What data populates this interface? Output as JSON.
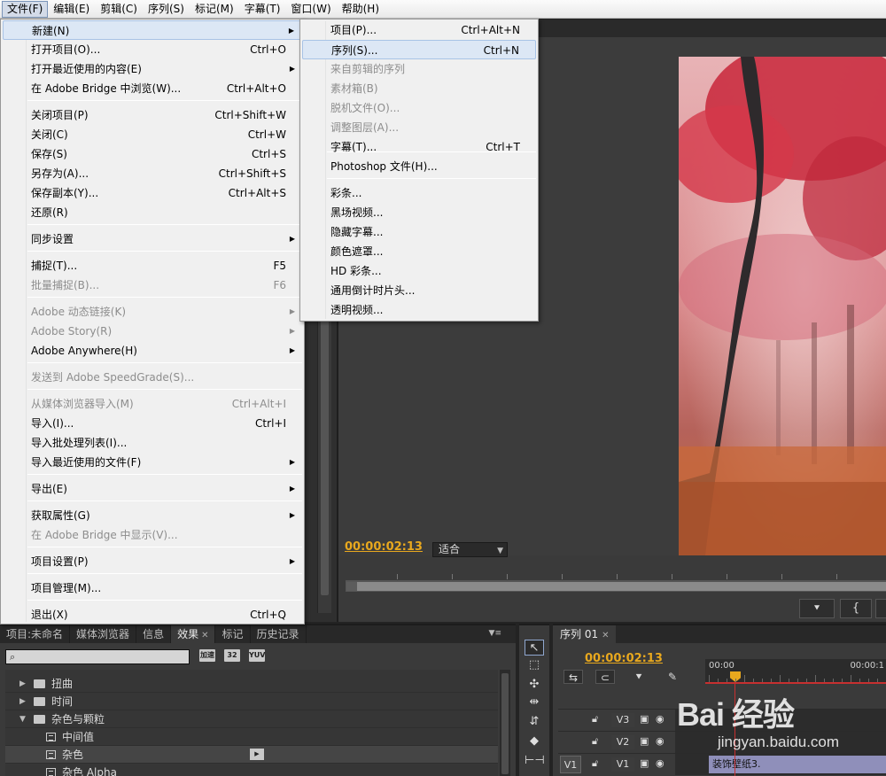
{
  "menubar": {
    "items": [
      {
        "label": "文件(F)"
      },
      {
        "label": "编辑(E)"
      },
      {
        "label": "剪辑(C)"
      },
      {
        "label": "序列(S)"
      },
      {
        "label": "标记(M)"
      },
      {
        "label": "字幕(T)"
      },
      {
        "label": "窗口(W)"
      },
      {
        "label": "帮助(H)"
      }
    ]
  },
  "file_menu": {
    "items": [
      {
        "label": "新建(N)",
        "shortcut": "",
        "submenu": true,
        "disabled": false,
        "highlighted": true
      },
      {
        "label": "打开项目(O)...",
        "shortcut": "Ctrl+O",
        "submenu": false,
        "disabled": false
      },
      {
        "label": "打开最近使用的内容(E)",
        "shortcut": "",
        "submenu": true,
        "disabled": false
      },
      {
        "label": "在 Adobe Bridge 中浏览(W)...",
        "shortcut": "Ctrl+Alt+O",
        "submenu": false,
        "disabled": false
      },
      {
        "label": "关闭项目(P)",
        "shortcut": "Ctrl+Shift+W",
        "submenu": false,
        "disabled": false
      },
      {
        "label": "关闭(C)",
        "shortcut": "Ctrl+W",
        "submenu": false,
        "disabled": false
      },
      {
        "label": "保存(S)",
        "shortcut": "Ctrl+S",
        "submenu": false,
        "disabled": false
      },
      {
        "label": "另存为(A)...",
        "shortcut": "Ctrl+Shift+S",
        "submenu": false,
        "disabled": false
      },
      {
        "label": "保存副本(Y)...",
        "shortcut": "Ctrl+Alt+S",
        "submenu": false,
        "disabled": false
      },
      {
        "label": "还原(R)",
        "shortcut": "",
        "submenu": false,
        "disabled": false
      },
      {
        "label": "同步设置",
        "shortcut": "",
        "submenu": true,
        "disabled": false
      },
      {
        "label": "捕捉(T)...",
        "shortcut": "F5",
        "submenu": false,
        "disabled": false
      },
      {
        "label": "批量捕捉(B)...",
        "shortcut": "F6",
        "submenu": false,
        "disabled": true
      },
      {
        "label": "Adobe 动态链接(K)",
        "shortcut": "",
        "submenu": true,
        "disabled": true
      },
      {
        "label": "Adobe Story(R)",
        "shortcut": "",
        "submenu": true,
        "disabled": true
      },
      {
        "label": "Adobe Anywhere(H)",
        "shortcut": "",
        "submenu": true,
        "disabled": false
      },
      {
        "label": "发送到 Adobe SpeedGrade(S)...",
        "shortcut": "",
        "submenu": false,
        "disabled": true
      },
      {
        "label": "从媒体浏览器导入(M)",
        "shortcut": "Ctrl+Alt+I",
        "submenu": false,
        "disabled": true
      },
      {
        "label": "导入(I)...",
        "shortcut": "Ctrl+I",
        "submenu": false,
        "disabled": false
      },
      {
        "label": "导入批处理列表(I)...",
        "shortcut": "",
        "submenu": false,
        "disabled": false
      },
      {
        "label": "导入最近使用的文件(F)",
        "shortcut": "",
        "submenu": true,
        "disabled": false
      },
      {
        "label": "导出(E)",
        "shortcut": "",
        "submenu": true,
        "disabled": false
      },
      {
        "label": "获取属性(G)",
        "shortcut": "",
        "submenu": true,
        "disabled": false
      },
      {
        "label": "在 Adobe Bridge 中显示(V)...",
        "shortcut": "",
        "submenu": false,
        "disabled": true
      },
      {
        "label": "项目设置(P)",
        "shortcut": "",
        "submenu": true,
        "disabled": false
      },
      {
        "label": "项目管理(M)...",
        "shortcut": "",
        "submenu": false,
        "disabled": false
      },
      {
        "label": "退出(X)",
        "shortcut": "Ctrl+Q",
        "submenu": false,
        "disabled": false
      }
    ]
  },
  "new_submenu": {
    "items": [
      {
        "label": "项目(P)...",
        "shortcut": "Ctrl+Alt+N",
        "disabled": false
      },
      {
        "label": "序列(S)...",
        "shortcut": "Ctrl+N",
        "disabled": false,
        "highlighted": true
      },
      {
        "label": "来自剪辑的序列",
        "shortcut": "",
        "disabled": true
      },
      {
        "label": "素材箱(B)",
        "shortcut": "",
        "disabled": true
      },
      {
        "label": "脱机文件(O)...",
        "shortcut": "",
        "disabled": true
      },
      {
        "label": "调整图层(A)...",
        "shortcut": "",
        "disabled": true
      },
      {
        "label": "字幕(T)...",
        "shortcut": "Ctrl+T",
        "disabled": false
      },
      {
        "label": "Photoshop 文件(H)...",
        "shortcut": "",
        "disabled": false
      },
      {
        "label": "彩条...",
        "shortcut": "",
        "disabled": false
      },
      {
        "label": "黑场视频...",
        "shortcut": "",
        "disabled": false
      },
      {
        "label": "隐藏字幕...",
        "shortcut": "",
        "disabled": false
      },
      {
        "label": "颜色遮罩...",
        "shortcut": "",
        "disabled": false
      },
      {
        "label": "HD 彩条...",
        "shortcut": "",
        "disabled": false
      },
      {
        "label": "通用倒计时片头...",
        "shortcut": "",
        "disabled": false
      },
      {
        "label": "透明视频...",
        "shortcut": "",
        "disabled": false
      }
    ]
  },
  "program_monitor": {
    "timecode": "00:00:02:13",
    "fit_label": "适合",
    "in_button_icon": "{",
    "marker_button_icon": "marker-icon"
  },
  "effects_panel": {
    "tabs": [
      {
        "label": "项目:未命名",
        "active": false,
        "closable": false
      },
      {
        "label": "媒体浏览器",
        "active": false,
        "closable": false
      },
      {
        "label": "信息",
        "active": false,
        "closable": false
      },
      {
        "label": "效果",
        "active": true,
        "closable": true
      },
      {
        "label": "标记",
        "active": false,
        "closable": false
      },
      {
        "label": "历史记录",
        "active": false,
        "closable": false
      }
    ],
    "tool_icons": [
      "accelerated-effects-icon",
      "32-bit-icon",
      "yuv-icon"
    ],
    "tool_labels": [
      "加速",
      "32",
      "YUV"
    ],
    "rows": [
      {
        "label": "扭曲",
        "type": "folder",
        "expanded": false
      },
      {
        "label": "时间",
        "type": "folder",
        "expanded": false
      },
      {
        "label": "杂色与颗粒",
        "type": "folder",
        "expanded": true
      },
      {
        "label": "中间值",
        "type": "effect"
      },
      {
        "label": "杂色",
        "type": "effect",
        "selected": true
      },
      {
        "label": "杂色 Alpha",
        "type": "effect"
      }
    ]
  },
  "timeline": {
    "tab_label": "序列 01",
    "timecode": "00:00:02:13",
    "ruler_start": "00:00",
    "ruler_end": "00:00:1",
    "tracks": [
      {
        "name": "V3",
        "source": ""
      },
      {
        "name": "V2",
        "source": ""
      },
      {
        "name": "V1",
        "source": "V1"
      }
    ],
    "clip_label": "装饰壁纸3."
  },
  "watermark": {
    "logo": "Bai  经验",
    "url": "jingyan.baidu.com"
  },
  "colors": {
    "timecode": "#e8a81e",
    "menu_highlight": "#dce7f5",
    "clip": "#8f8fba"
  }
}
